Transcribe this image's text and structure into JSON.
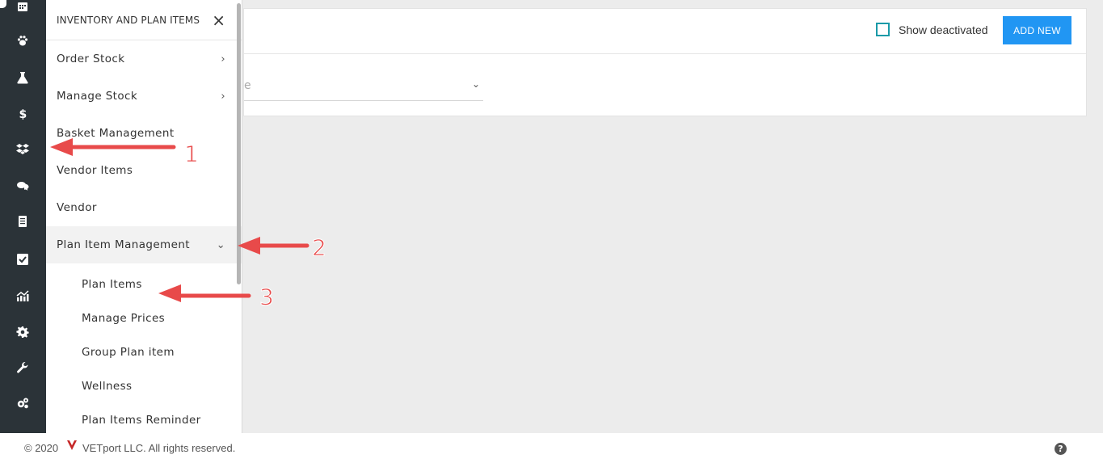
{
  "rail": {
    "icons": [
      "calendar-icon",
      "paw-icon",
      "flask-icon",
      "dollar-icon",
      "boxes-icon",
      "chat-icon",
      "document-icon",
      "checklist-icon",
      "chart-icon",
      "gear-icon",
      "wrench-icon",
      "gears-icon"
    ],
    "background": "#2b3338"
  },
  "drawer": {
    "title": "INVENTORY AND PLAN ITEMS",
    "close_icon": "×",
    "items": [
      {
        "label": "Order Stock",
        "chevron": "›"
      },
      {
        "label": "Manage Stock",
        "chevron": "›"
      },
      {
        "label": "Basket Management",
        "chevron": ""
      },
      {
        "label": "Vendor Items",
        "chevron": ""
      },
      {
        "label": "Vendor",
        "chevron": ""
      },
      {
        "label": "Plan Item Management",
        "chevron": "⌄"
      }
    ],
    "sub_items": [
      {
        "label": "Plan Items"
      },
      {
        "label": "Manage Prices"
      },
      {
        "label": "Group Plan item"
      },
      {
        "label": "Wellness"
      },
      {
        "label": "Plan Items Reminder"
      }
    ]
  },
  "main": {
    "show_deactivated_label": "Show deactivated",
    "add_new_label": "ADD NEW",
    "select_partial_text": "e",
    "select_chevron": "⌄"
  },
  "footer": {
    "copyright": "© 2020",
    "company": "VETport LLC. All rights reserved.",
    "help": "?"
  },
  "annotations": {
    "numbers": [
      "1",
      "2",
      "3"
    ],
    "color": "#e84a4a"
  },
  "colors": {
    "accent": "#2196f3",
    "checkbox": "#1a9aa8"
  }
}
